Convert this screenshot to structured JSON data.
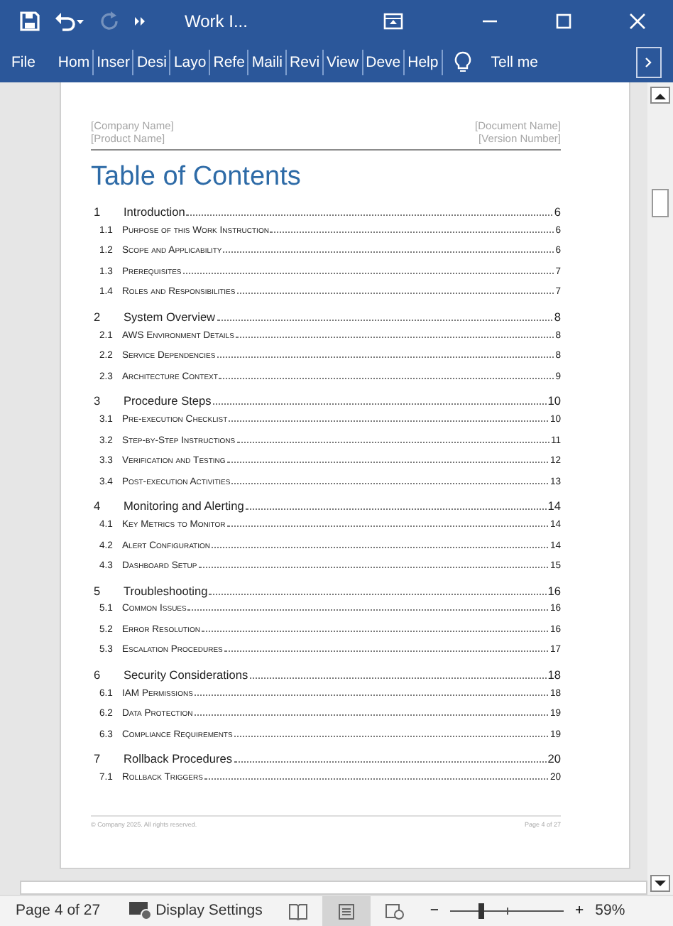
{
  "window": {
    "title": "Work I..."
  },
  "quick_access": [
    {
      "kind": "save",
      "disabled": false
    },
    {
      "kind": "undo",
      "disabled": false
    },
    {
      "kind": "redo",
      "disabled": true
    },
    {
      "kind": "more",
      "disabled": false
    }
  ],
  "ribbon": {
    "tabs": [
      {
        "label": "File",
        "selected": false
      },
      {
        "label": "Hom",
        "selected": false
      },
      {
        "label": "Inser",
        "selected": false
      },
      {
        "label": "Desi",
        "selected": false
      },
      {
        "label": "Layo",
        "selected": false
      },
      {
        "label": "Refe",
        "selected": false
      },
      {
        "label": "Maili",
        "selected": false
      },
      {
        "label": "Revi",
        "selected": false
      },
      {
        "label": "View",
        "selected": false
      },
      {
        "label": "Deve",
        "selected": false
      },
      {
        "label": "Help",
        "selected": false
      }
    ],
    "tell_me": "Tell me"
  },
  "document": {
    "header": {
      "left": [
        "[Company Name]",
        "[Product Name]"
      ],
      "right": [
        "[Document Name]",
        "[Version Number]"
      ]
    },
    "toc_title": "Table of Contents",
    "entries": [
      {
        "number": "1",
        "title": "Introduction",
        "page": "6",
        "children": [
          {
            "number": "1.1",
            "title": "Purpose of this Work Instruction",
            "page": "6"
          },
          {
            "number": "1.2",
            "title": "Scope and Applicability",
            "page": "6"
          },
          {
            "number": "1.3",
            "title": "Prerequisites",
            "page": "7"
          },
          {
            "number": "1.4",
            "title": "Roles and Responsibilities",
            "page": "7"
          }
        ]
      },
      {
        "number": "2",
        "title": "System Overview",
        "page": "8",
        "children": [
          {
            "number": "2.1",
            "title": "AWS Environment Details",
            "page": "8"
          },
          {
            "number": "2.2",
            "title": "Service Dependencies",
            "page": "8"
          },
          {
            "number": "2.3",
            "title": "Architecture Context",
            "page": "9"
          }
        ]
      },
      {
        "number": "3",
        "title": "Procedure Steps",
        "page": "10",
        "children": [
          {
            "number": "3.1",
            "title": "Pre-execution Checklist",
            "page": "10"
          },
          {
            "number": "3.2",
            "title": "Step-by-Step Instructions",
            "page": "11"
          },
          {
            "number": "3.3",
            "title": "Verification and Testing",
            "page": "12"
          },
          {
            "number": "3.4",
            "title": "Post-execution Activities",
            "page": "13"
          }
        ]
      },
      {
        "number": "4",
        "title": "Monitoring and Alerting",
        "page": "14",
        "children": [
          {
            "number": "4.1",
            "title": "Key Metrics to Monitor",
            "page": "14"
          },
          {
            "number": "4.2",
            "title": "Alert Configuration",
            "page": "14"
          },
          {
            "number": "4.3",
            "title": "Dashboard Setup",
            "page": "15"
          }
        ]
      },
      {
        "number": "5",
        "title": "Troubleshooting",
        "page": "16",
        "children": [
          {
            "number": "5.1",
            "title": "Common Issues",
            "page": "16"
          },
          {
            "number": "5.2",
            "title": "Error Resolution",
            "page": "16"
          },
          {
            "number": "5.3",
            "title": "Escalation Procedures",
            "page": "17"
          }
        ]
      },
      {
        "number": "6",
        "title": "Security Considerations",
        "page": "18",
        "children": [
          {
            "number": "6.1",
            "title": "IAM Permissions",
            "page": "18"
          },
          {
            "number": "6.2",
            "title": "Data Protection",
            "page": "19"
          },
          {
            "number": "6.3",
            "title": "Compliance Requirements",
            "page": "19"
          }
        ]
      },
      {
        "number": "7",
        "title": "Rollback Procedures",
        "page": "20",
        "children": [
          {
            "number": "7.1",
            "title": "Rollback Triggers",
            "page": "20"
          }
        ]
      }
    ],
    "footer": {
      "left": "© Company 2025. All rights reserved.",
      "right": "Page 4 of 27"
    }
  },
  "status_bar": {
    "page": "Page 4 of 27",
    "display_settings": "Display Settings",
    "views": [
      {
        "kind": "read",
        "selected": false
      },
      {
        "kind": "print",
        "selected": true
      },
      {
        "kind": "web",
        "selected": false
      }
    ],
    "zoom": {
      "minus": "−",
      "plus": "+",
      "level": 0.27,
      "reading": "59%"
    }
  }
}
